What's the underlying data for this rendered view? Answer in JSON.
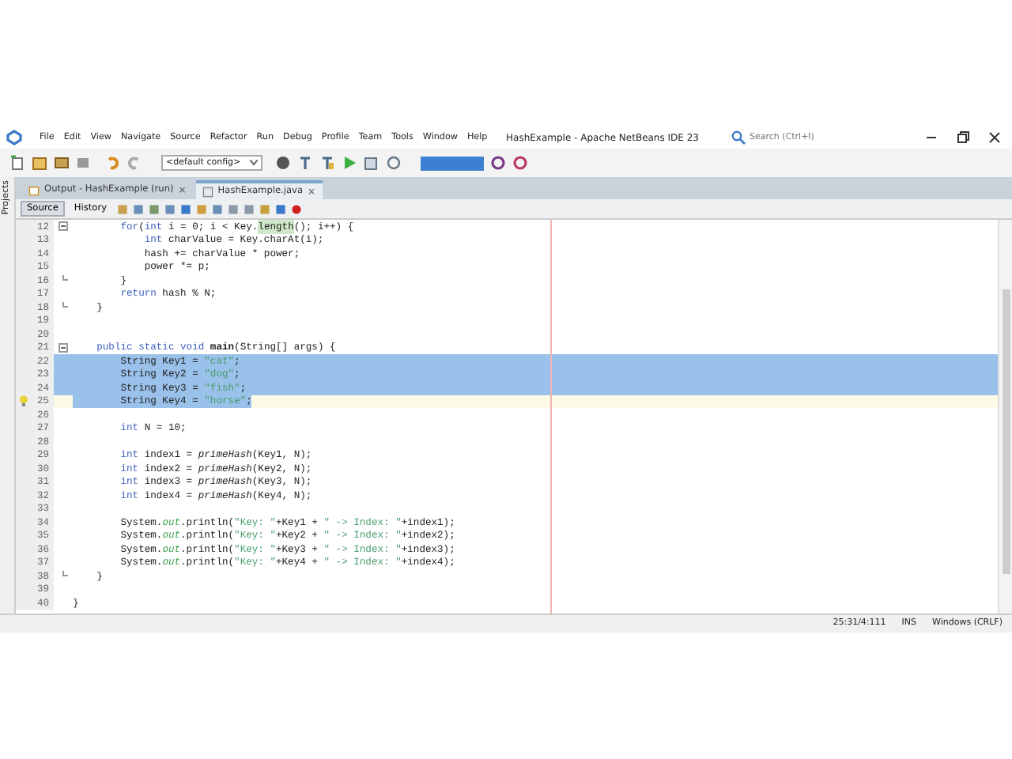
{
  "window": {
    "title": "HashExample - Apache NetBeans IDE 23"
  },
  "menu": [
    "File",
    "Edit",
    "View",
    "Navigate",
    "Source",
    "Refactor",
    "Run",
    "Debug",
    "Profile",
    "Team",
    "Tools",
    "Window",
    "Help"
  ],
  "search": {
    "placeholder": "Search (Ctrl+I)"
  },
  "toolbar": {
    "config": "<default config>"
  },
  "side_tab": "Projects",
  "tabs": [
    {
      "label": "Output - HashExample (run)",
      "selected": false,
      "close": "×"
    },
    {
      "label": "HashExample.java",
      "selected": true,
      "close": "×"
    }
  ],
  "editor_tabs": [
    {
      "label": "Source",
      "selected": true
    },
    {
      "label": "History",
      "selected": false
    }
  ],
  "lines": [
    {
      "num": "12",
      "fold_start": true,
      "segs": [
        {
          "kind": "kw",
          "text": "        for"
        },
        {
          "kind": "plain",
          "text": "("
        },
        {
          "kind": "kw",
          "text": "int"
        },
        {
          "kind": "plain",
          "text": " i = 0; i < Key."
        },
        {
          "kind": "hl",
          "text": "length"
        },
        {
          "kind": "plain",
          "text": "(); i++) {"
        }
      ]
    },
    {
      "num": "13",
      "segs": [
        {
          "kind": "kw",
          "text": "            int"
        },
        {
          "kind": "plain",
          "text": " charValue = Key.charAt(i);"
        }
      ]
    },
    {
      "num": "14",
      "segs": [
        {
          "kind": "plain",
          "text": "            hash += charValue * power;"
        }
      ]
    },
    {
      "num": "15",
      "segs": [
        {
          "kind": "plain",
          "text": "            power *= p;"
        }
      ]
    },
    {
      "num": "16",
      "fold_end": true,
      "segs": [
        {
          "kind": "plain",
          "text": "        }"
        }
      ]
    },
    {
      "num": "17",
      "segs": [
        {
          "kind": "kw",
          "text": "        return"
        },
        {
          "kind": "plain",
          "text": " hash % N;"
        }
      ]
    },
    {
      "num": "18",
      "fold_end": true,
      "segs": [
        {
          "kind": "plain",
          "text": "    }"
        }
      ]
    },
    {
      "num": "19"
    },
    {
      "num": "20"
    },
    {
      "num": "21",
      "fold_start": true,
      "segs": [
        {
          "kind": "kw",
          "text": "    public static void "
        },
        {
          "kind": "bold",
          "text": "main"
        },
        {
          "kind": "plain",
          "text": "(String[] args) {"
        }
      ]
    },
    {
      "num": "22",
      "selected": true,
      "segs": [
        {
          "kind": "plain",
          "text": "        String Key1 = "
        },
        {
          "kind": "str",
          "text": "\"cat\""
        },
        {
          "kind": "plain",
          "text": ";"
        }
      ]
    },
    {
      "num": "23",
      "selected": true,
      "segs": [
        {
          "kind": "plain",
          "text": "        String Key2 = "
        },
        {
          "kind": "str",
          "text": "\"dog\""
        },
        {
          "kind": "plain",
          "text": ";"
        }
      ]
    },
    {
      "num": "24",
      "selected": true,
      "segs": [
        {
          "kind": "plain",
          "text": "        String Key3 = "
        },
        {
          "kind": "str",
          "text": "\"fish\""
        },
        {
          "kind": "plain",
          "text": ";"
        }
      ]
    },
    {
      "num": "25",
      "selected": true,
      "current": true,
      "hint": true,
      "segs": [
        {
          "kind": "plain",
          "text": "        String Key4 = "
        },
        {
          "kind": "str",
          "text": "\"horse\""
        },
        {
          "kind": "plain",
          "text": ";"
        }
      ]
    },
    {
      "num": "26"
    },
    {
      "num": "27",
      "segs": [
        {
          "kind": "kw",
          "text": "        int"
        },
        {
          "kind": "plain",
          "text": " N = 10;"
        }
      ]
    },
    {
      "num": "28"
    },
    {
      "num": "29",
      "segs": [
        {
          "kind": "kw",
          "text": "        int"
        },
        {
          "kind": "plain",
          "text": " index1 = "
        },
        {
          "kind": "static",
          "text": "primeHash"
        },
        {
          "kind": "plain",
          "text": "(Key1, N);"
        }
      ]
    },
    {
      "num": "30",
      "segs": [
        {
          "kind": "kw",
          "text": "        int"
        },
        {
          "kind": "plain",
          "text": " index2 = "
        },
        {
          "kind": "static",
          "text": "primeHash"
        },
        {
          "kind": "plain",
          "text": "(Key2, N);"
        }
      ]
    },
    {
      "num": "31",
      "segs": [
        {
          "kind": "kw",
          "text": "        int"
        },
        {
          "kind": "plain",
          "text": " index3 = "
        },
        {
          "kind": "static",
          "text": "primeHash"
        },
        {
          "kind": "plain",
          "text": "(Key3, N);"
        }
      ]
    },
    {
      "num": "32",
      "segs": [
        {
          "kind": "kw",
          "text": "        int"
        },
        {
          "kind": "plain",
          "text": " index4 = "
        },
        {
          "kind": "static",
          "text": "primeHash"
        },
        {
          "kind": "plain",
          "text": "(Key4, N);"
        }
      ]
    },
    {
      "num": "33"
    },
    {
      "num": "34",
      "segs": [
        {
          "kind": "plain",
          "text": "        System."
        },
        {
          "kind": "field",
          "text": "out"
        },
        {
          "kind": "plain",
          "text": ".println("
        },
        {
          "kind": "str",
          "text": "\"Key: \""
        },
        {
          "kind": "plain",
          "text": "+Key1 + "
        },
        {
          "kind": "str",
          "text": "\" -> Index: \""
        },
        {
          "kind": "plain",
          "text": "+index1);"
        }
      ]
    },
    {
      "num": "35",
      "segs": [
        {
          "kind": "plain",
          "text": "        System."
        },
        {
          "kind": "field",
          "text": "out"
        },
        {
          "kind": "plain",
          "text": ".println("
        },
        {
          "kind": "str",
          "text": "\"Key: \""
        },
        {
          "kind": "plain",
          "text": "+Key2 + "
        },
        {
          "kind": "str",
          "text": "\" -> Index: \""
        },
        {
          "kind": "plain",
          "text": "+index2);"
        }
      ]
    },
    {
      "num": "36",
      "segs": [
        {
          "kind": "plain",
          "text": "        System."
        },
        {
          "kind": "field",
          "text": "out"
        },
        {
          "kind": "plain",
          "text": ".println("
        },
        {
          "kind": "str",
          "text": "\"Key: \""
        },
        {
          "kind": "plain",
          "text": "+Key3 + "
        },
        {
          "kind": "str",
          "text": "\" -> Index: \""
        },
        {
          "kind": "plain",
          "text": "+index3);"
        }
      ]
    },
    {
      "num": "37",
      "segs": [
        {
          "kind": "plain",
          "text": "        System."
        },
        {
          "kind": "field",
          "text": "out"
        },
        {
          "kind": "plain",
          "text": ".println("
        },
        {
          "kind": "str",
          "text": "\"Key: \""
        },
        {
          "kind": "plain",
          "text": "+Key4 + "
        },
        {
          "kind": "str",
          "text": "\" -> Index: \""
        },
        {
          "kind": "plain",
          "text": "+index4);"
        }
      ]
    },
    {
      "num": "38",
      "fold_end": true,
      "segs": [
        {
          "kind": "plain",
          "text": "    }"
        }
      ]
    },
    {
      "num": "39"
    },
    {
      "num": "40",
      "segs": [
        {
          "kind": "plain",
          "text": "}"
        }
      ]
    }
  ],
  "status_bar": {
    "position": "25:31/4:111",
    "mode": "INS",
    "line_endings": "Windows (CRLF)"
  }
}
